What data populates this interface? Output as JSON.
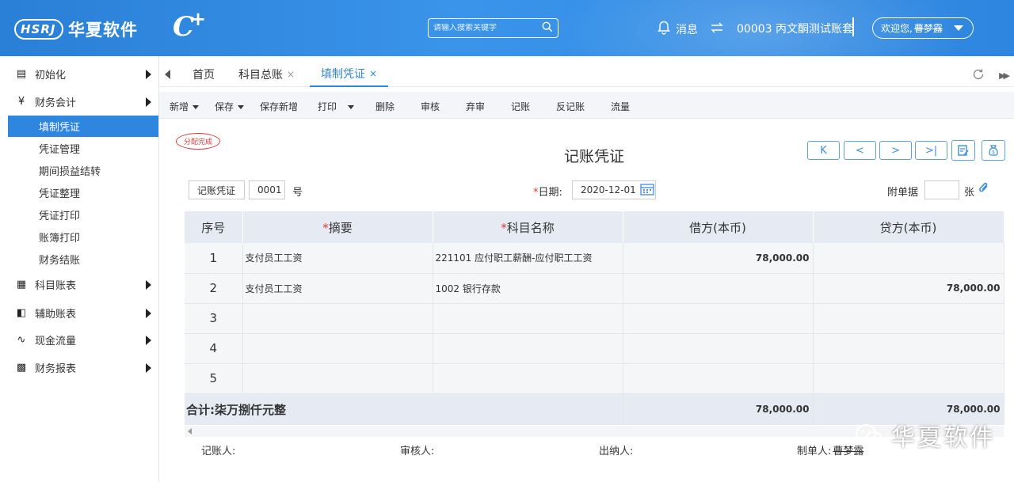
{
  "header": {
    "brand": "华夏软件",
    "brand_mark": "HSRJ",
    "search_placeholder": "请输入搜索关键字",
    "messages": "消息",
    "account": "00003 丙文酮测试账套",
    "user_greeting": "欢迎您,",
    "user_name": "曹梦露"
  },
  "sidebar": {
    "groups": [
      {
        "label": "初始化",
        "icon": "database-icon"
      },
      {
        "label": "财务会计",
        "icon": "yen-icon"
      },
      {
        "label": "科目账表",
        "icon": "document-icon"
      },
      {
        "label": "辅助账表",
        "icon": "copy-icon"
      },
      {
        "label": "现金流量",
        "icon": "flow-icon"
      },
      {
        "label": "财务报表",
        "icon": "calculator-icon"
      }
    ],
    "items": [
      "填制凭证",
      "凭证管理",
      "期间损益结转",
      "凭证整理",
      "凭证打印",
      "账簿打印",
      "财务结账"
    ]
  },
  "tabs": [
    {
      "label": "首页"
    },
    {
      "label": "科目总账"
    },
    {
      "label": "填制凭证"
    }
  ],
  "toolbar": {
    "new": "新增",
    "save": "保存",
    "save_new": "保存新增",
    "print": "打印",
    "delete": "删除",
    "audit": "审核",
    "reject": "弃审",
    "post": "记账",
    "unpost": "反记账",
    "flow": "流量"
  },
  "voucher": {
    "stamp": "分配完成",
    "title": "记账凭证",
    "type": "记账凭证",
    "number": "0001",
    "number_suffix": "号",
    "date_label": "日期:",
    "date": "2020-12-01",
    "attach_label": "附单据",
    "attach_count": "",
    "attach_unit": "张",
    "columns": [
      "序号",
      "摘要",
      "科目名称",
      "借方(本币)",
      "贷方(本币)"
    ],
    "rows": [
      {
        "idx": "1",
        "summary": "支付员工工资",
        "account": "221101 应付职工薪酬-应付职工工资",
        "debit": "78,000.00",
        "credit": ""
      },
      {
        "idx": "2",
        "summary": "支付员工工资",
        "account": "1002 银行存款",
        "debit": "",
        "credit": "78,000.00"
      },
      {
        "idx": "3",
        "summary": "",
        "account": "",
        "debit": "",
        "credit": ""
      },
      {
        "idx": "4",
        "summary": "",
        "account": "",
        "debit": "",
        "credit": ""
      },
      {
        "idx": "5",
        "summary": "",
        "account": "",
        "debit": "",
        "credit": ""
      }
    ],
    "total_label": "合计:柒万捌仟元整",
    "total_debit": "78,000.00",
    "total_credit": "78,000.00"
  },
  "signatures": {
    "bookkeeper": "记账人:",
    "auditor": "审核人:",
    "cashier": "出纳人:",
    "maker": "制单人:",
    "maker_name": "曹梦露"
  },
  "watermark": "华夏软件",
  "colors": {
    "primary": "#2f86df",
    "header": "#3a94ea",
    "required": "#e03a3a",
    "stamp": "#d83b3b"
  }
}
